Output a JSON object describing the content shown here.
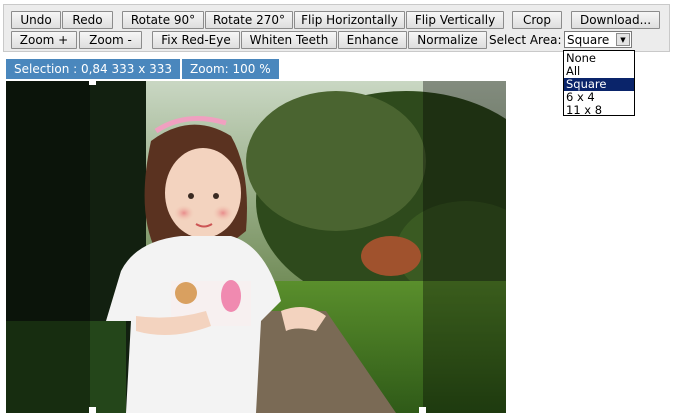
{
  "toolbar": {
    "row1": {
      "undo": "Undo",
      "redo": "Redo",
      "rotate_90": "Rotate 90°",
      "rotate_270": "Rotate 270°",
      "flip_h": "Flip Horizontally",
      "flip_v": "Flip Vertically",
      "crop": "Crop",
      "download": "Download..."
    },
    "row2": {
      "zoom_in": "Zoom +",
      "zoom_out": "Zoom -",
      "fix_red_eye": "Fix Red-Eye",
      "whiten_teeth": "Whiten Teeth",
      "enhance": "Enhance",
      "normalize": "Normalize"
    },
    "select_area": {
      "label": "Select Area:",
      "selected": "Square",
      "options": [
        "None",
        "All",
        "Square",
        "6 x 4",
        "11 x 8"
      ]
    }
  },
  "status": {
    "selection": "Selection : 0,84 333 x 333",
    "zoom": "Zoom: 100 %"
  },
  "colors": {
    "status_bg": "#4a87bd",
    "dropdown_highlight": "#0a246a",
    "toolbar_bg": "#ececec"
  }
}
